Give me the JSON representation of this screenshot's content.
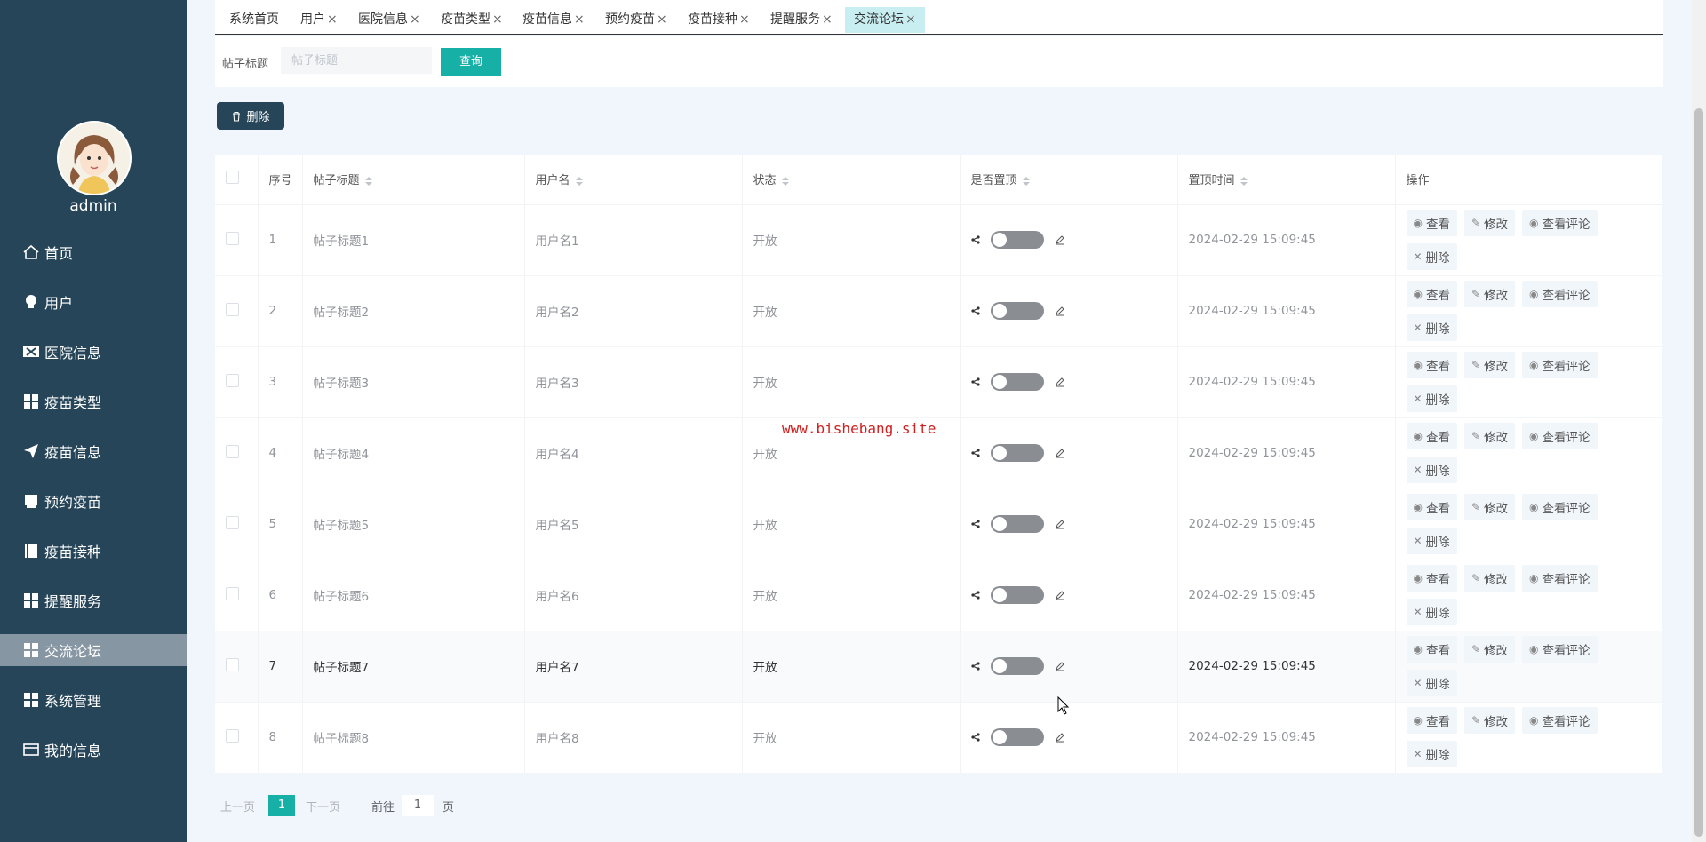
{
  "user": {
    "name": "admin"
  },
  "sidebar": {
    "items": [
      {
        "label": "首页",
        "icon": "home-icon"
      },
      {
        "label": "用户",
        "icon": "bulb-icon"
      },
      {
        "label": "医院信息",
        "icon": "hospital-icon"
      },
      {
        "label": "疫苗类型",
        "icon": "grid-icon"
      },
      {
        "label": "疫苗信息",
        "icon": "send-icon"
      },
      {
        "label": "预约疫苗",
        "icon": "ticket-icon"
      },
      {
        "label": "疫苗接种",
        "icon": "book-icon"
      },
      {
        "label": "提醒服务",
        "icon": "grid-icon"
      },
      {
        "label": "交流论坛",
        "icon": "grid-icon",
        "active": true
      },
      {
        "label": "系统管理",
        "icon": "grid-icon"
      },
      {
        "label": "我的信息",
        "icon": "card-icon"
      }
    ]
  },
  "tabs": [
    {
      "label": "系统首页"
    },
    {
      "label": "用户"
    },
    {
      "label": "医院信息"
    },
    {
      "label": "疫苗类型"
    },
    {
      "label": "疫苗信息"
    },
    {
      "label": "预约疫苗"
    },
    {
      "label": "疫苗接种"
    },
    {
      "label": "提醒服务"
    },
    {
      "label": "交流论坛",
      "active": true
    }
  ],
  "search": {
    "label": "帖子标题",
    "placeholder": "帖子标题",
    "button": "查询"
  },
  "toolbar": {
    "delete_label": "删除"
  },
  "table": {
    "headers": [
      "序号",
      "帖子标题",
      "用户名",
      "状态",
      "是否置顶",
      "置顶时间",
      "操作"
    ],
    "rows": [
      {
        "index": "1",
        "title": "帖子标题1",
        "user": "用户名1",
        "status": "开放",
        "time": "2024-02-29 15:09:45"
      },
      {
        "index": "2",
        "title": "帖子标题2",
        "user": "用户名2",
        "status": "开放",
        "time": "2024-02-29 15:09:45"
      },
      {
        "index": "3",
        "title": "帖子标题3",
        "user": "用户名3",
        "status": "开放",
        "time": "2024-02-29 15:09:45"
      },
      {
        "index": "4",
        "title": "帖子标题4",
        "user": "用户名4",
        "status": "开放",
        "time": "2024-02-29 15:09:45"
      },
      {
        "index": "5",
        "title": "帖子标题5",
        "user": "用户名5",
        "status": "开放",
        "time": "2024-02-29 15:09:45"
      },
      {
        "index": "6",
        "title": "帖子标题6",
        "user": "用户名6",
        "status": "开放",
        "time": "2024-02-29 15:09:45"
      },
      {
        "index": "7",
        "title": "帖子标题7",
        "user": "用户名7",
        "status": "开放",
        "time": "2024-02-29 15:09:45"
      },
      {
        "index": "8",
        "title": "帖子标题8",
        "user": "用户名8",
        "status": "开放",
        "time": "2024-02-29 15:09:45"
      }
    ],
    "actions": {
      "view": "查看",
      "edit": "修改",
      "comments": "查看评论",
      "delete": "删除"
    }
  },
  "watermark": "www.bishebang.site",
  "pagination": {
    "prev": "上一页",
    "current": "1",
    "next": "下一页",
    "goto": "前往",
    "goto_value": "1",
    "page_suffix": "页"
  },
  "colors": {
    "sidebar": "#264559",
    "accent": "#17b0a6",
    "active_menu": "#8796a3"
  }
}
